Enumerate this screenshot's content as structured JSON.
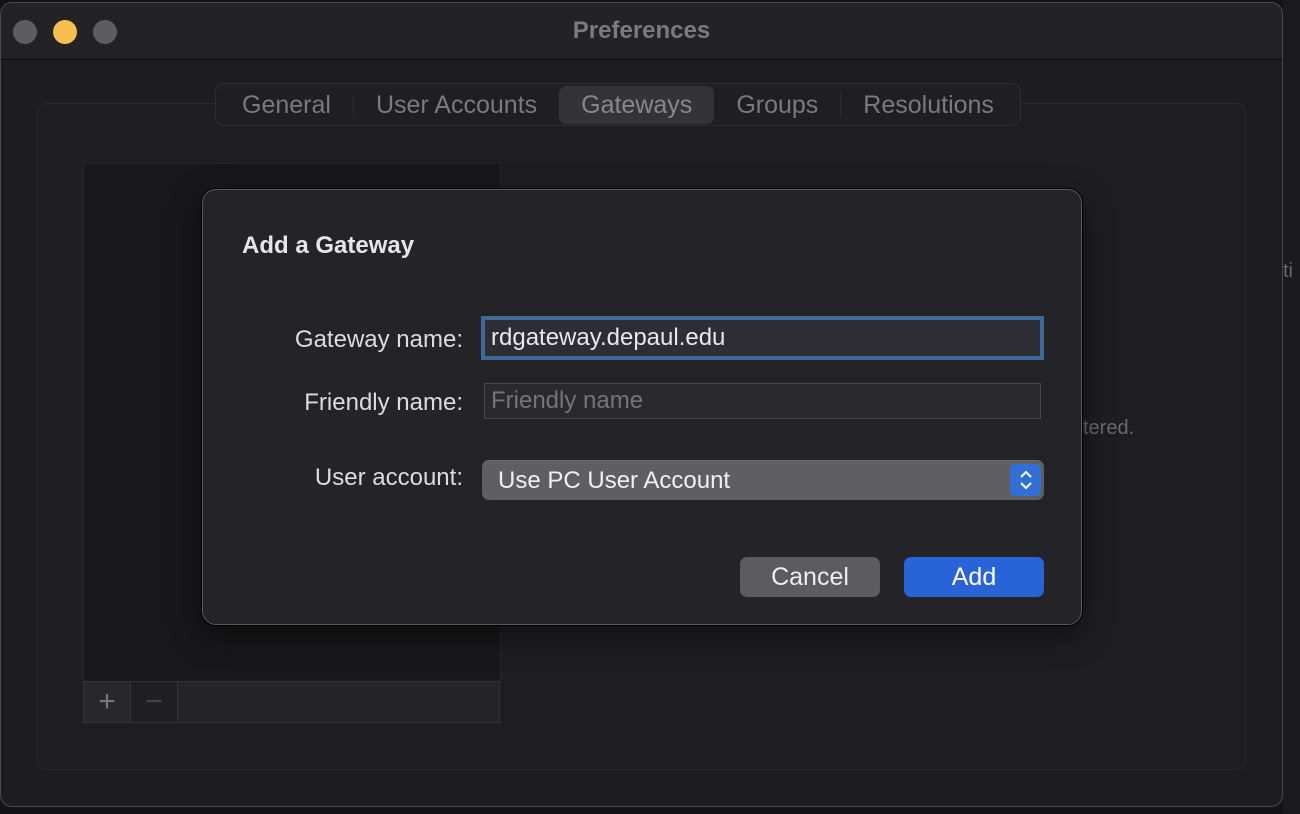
{
  "window": {
    "title": "Preferences",
    "traffic_lights": [
      "close",
      "minimize",
      "maximize"
    ]
  },
  "tabs": [
    {
      "label": "General",
      "active": false
    },
    {
      "label": "User Accounts",
      "active": false
    },
    {
      "label": "Gateways",
      "active": true
    },
    {
      "label": "Groups",
      "active": false
    },
    {
      "label": "Resolutions",
      "active": false
    }
  ],
  "list_toolbar": {
    "add_icon": "+",
    "remove_icon": "−"
  },
  "background": {
    "partial_text_1": "ti",
    "partial_text_2": "tered."
  },
  "dialog": {
    "title": "Add a Gateway",
    "gateway_name_label": "Gateway name:",
    "gateway_name_value": "rdgateway.depaul.edu",
    "friendly_name_label": "Friendly name:",
    "friendly_name_value": "",
    "friendly_name_placeholder": "Friendly name",
    "user_account_label": "User account:",
    "user_account_value": "Use PC User Account",
    "cancel_label": "Cancel",
    "add_label": "Add"
  },
  "colors": {
    "accent": "#2864d8",
    "focus_ring": "#3d6a99",
    "minimize_light": "#f4bf4f"
  }
}
